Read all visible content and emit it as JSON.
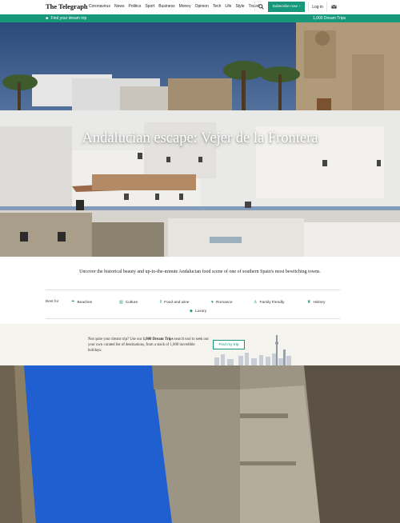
{
  "header": {
    "logo": "The Telegraph",
    "nav": [
      "Coronavirus",
      "News",
      "Politics",
      "Sport",
      "Business",
      "Money",
      "Opinion",
      "Tech",
      "Life",
      "Style",
      "Travel"
    ],
    "more": "›",
    "subscribe_label": "Subscribe now",
    "login_label": "Log in"
  },
  "trip_bar": {
    "left_label": "Find your dream trip",
    "right_label": "1,000 Dream Trips"
  },
  "hero": {
    "title": "Andalucian escape: Vejer de la Frontera"
  },
  "intro": "Uncover the historical beauty and up-to-the-minute Andalucian food scene of one of southern Spain's most bewitching towns.",
  "best_for": {
    "label": "Best for",
    "chips": [
      {
        "label": "Beaches",
        "icon": "umbrella-icon"
      },
      {
        "label": "Culture",
        "icon": "museum-icon"
      },
      {
        "label": "Food and wine",
        "icon": "cutlery-icon"
      },
      {
        "label": "Romance",
        "icon": "heart-icon"
      },
      {
        "label": "Family friendly",
        "icon": "family-icon"
      },
      {
        "label": "History",
        "icon": "castle-icon"
      },
      {
        "label": "Luxury",
        "icon": "diamond-icon"
      }
    ]
  },
  "banner": {
    "text_pre": "Not quite your dream trip? Use our ",
    "text_bold": "1,000 Dream Trips",
    "text_post": " search tool to seek out your own curated list of destinations, from a stack of 1,000 incredible holidays.",
    "button_label": "Find my trip"
  },
  "colors": {
    "accent": "#17987a",
    "banner_bg": "#f5f3ee"
  }
}
